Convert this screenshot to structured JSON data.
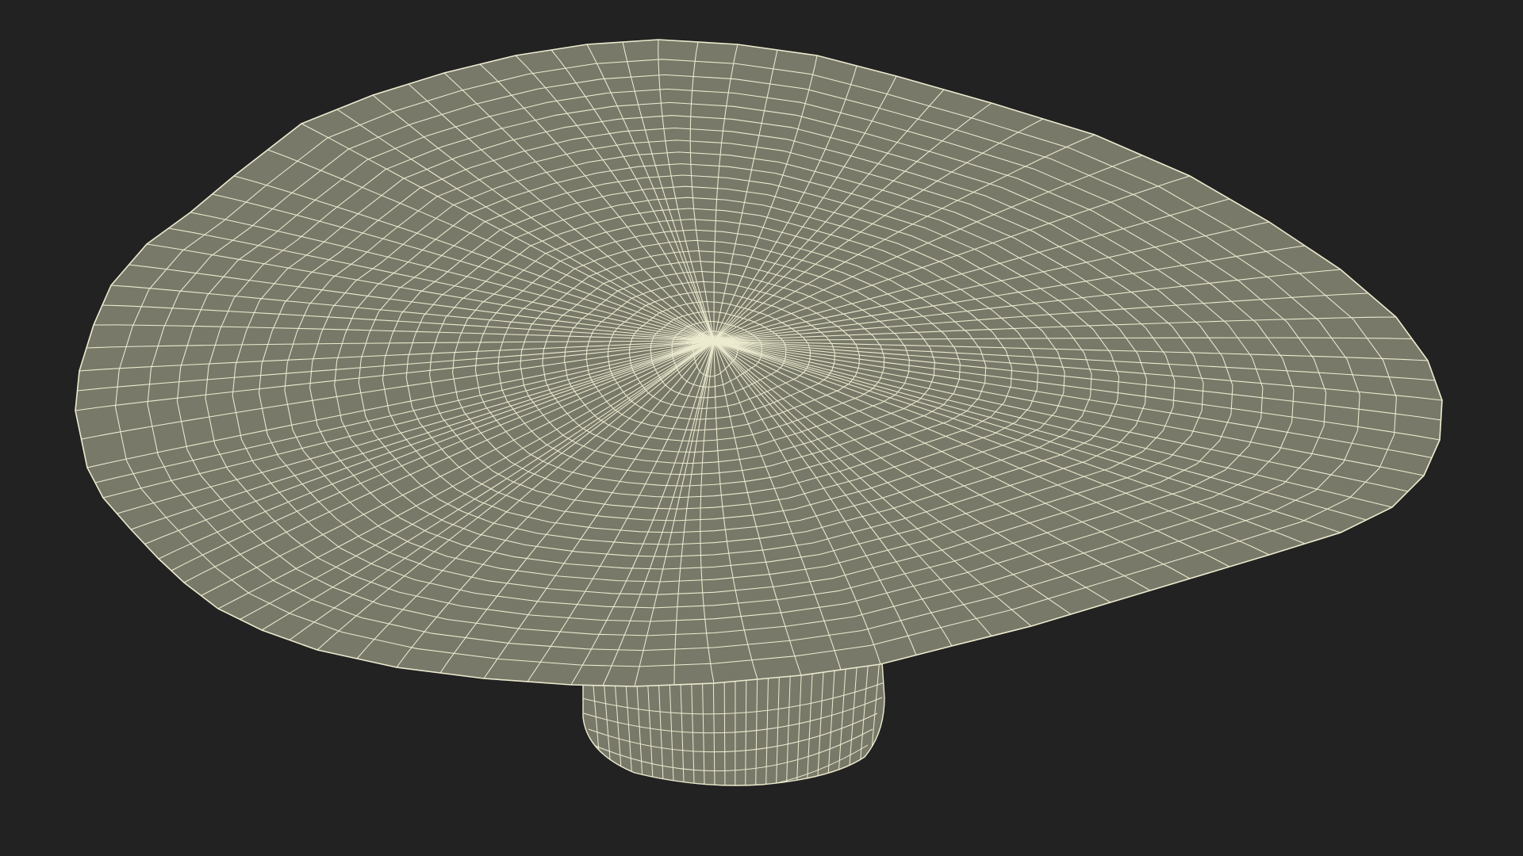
{
  "scene": {
    "background_color": "#222222",
    "mesh_fill_color": "#79796A",
    "wire_color": "#EDEBCF",
    "model": "mushroom-shaped-wireframe"
  }
}
